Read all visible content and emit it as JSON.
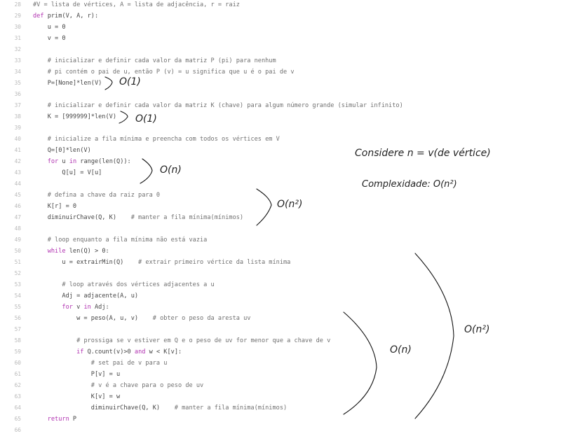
{
  "lines": [
    {
      "n": "28",
      "html": "<span class=\"cm\">#V = lista de vértices, A = lista de adjacência, r = raiz</span>"
    },
    {
      "n": "29",
      "html": "<span class=\"kw\">def</span> prim(V, A, r):"
    },
    {
      "n": "30",
      "html": "    u = 0"
    },
    {
      "n": "31",
      "html": "    v = 0"
    },
    {
      "n": "32",
      "html": ""
    },
    {
      "n": "33",
      "html": "    <span class=\"cm\"># inicializar e definir cada valor da matriz P (pi) para nenhum</span>"
    },
    {
      "n": "34",
      "html": "    <span class=\"cm\"># pi contém o pai de u, então P (v) = u significa que u é o pai de v</span>"
    },
    {
      "n": "35",
      "html": "    P=[None]*len(V)"
    },
    {
      "n": "36",
      "html": ""
    },
    {
      "n": "37",
      "html": "    <span class=\"cm\"># inicializar e definir cada valor da matriz K (chave) para algum número grande (simular infinito)</span>"
    },
    {
      "n": "38",
      "html": "    K = [999999]*len(V)"
    },
    {
      "n": "39",
      "html": ""
    },
    {
      "n": "40",
      "html": "    <span class=\"cm\"># inicialize a fila mínima e preencha com todos os vértices em V</span>"
    },
    {
      "n": "41",
      "html": "    Q=[0]*len(V)"
    },
    {
      "n": "42",
      "html": "    <span class=\"kw\">for</span> u <span class=\"kw\">in</span> range(len(Q)):"
    },
    {
      "n": "43",
      "html": "        Q[u] = V[u]"
    },
    {
      "n": "44",
      "html": ""
    },
    {
      "n": "45",
      "html": "    <span class=\"cm\"># defina a chave da raiz para 0</span>"
    },
    {
      "n": "46",
      "html": "    K[r] = 0"
    },
    {
      "n": "47",
      "html": "    diminuirChave(Q, K)    <span class=\"cm\"># manter a fila mínima(mínimos)</span>"
    },
    {
      "n": "48",
      "html": ""
    },
    {
      "n": "49",
      "html": "    <span class=\"cm\"># loop enquanto a fila mínima não está vazia</span>"
    },
    {
      "n": "50",
      "html": "    <span class=\"kw\">while</span> len(Q) &gt; 0:"
    },
    {
      "n": "51",
      "html": "        u = extrairMin(Q)    <span class=\"cm\"># extrair primeiro vértice da lista mínima</span>"
    },
    {
      "n": "52",
      "html": ""
    },
    {
      "n": "53",
      "html": "        <span class=\"cm\"># loop através dos vértices adjacentes a u</span>"
    },
    {
      "n": "54",
      "html": "        Adj = adjacente(A, u)"
    },
    {
      "n": "55",
      "html": "        <span class=\"kw\">for</span> v <span class=\"kw\">in</span> Adj:"
    },
    {
      "n": "56",
      "html": "            w = peso(A, u, v)    <span class=\"cm\"># obter o peso da aresta uv</span>"
    },
    {
      "n": "57",
      "html": ""
    },
    {
      "n": "58",
      "html": "            <span class=\"cm\"># prossiga se v estiver em Q e o peso de uv for menor que a chave de v</span>"
    },
    {
      "n": "59",
      "html": "            <span class=\"kw\">if</span> Q.count(v)&gt;0 <span class=\"kw\">and</span> w &lt; K[v]:"
    },
    {
      "n": "60",
      "html": "                <span class=\"cm\"># set pai de v para u</span>"
    },
    {
      "n": "61",
      "html": "                P[v] = u"
    },
    {
      "n": "62",
      "html": "                <span class=\"cm\"># v é a chave para o peso de uv</span>"
    },
    {
      "n": "63",
      "html": "                K[v] = w"
    },
    {
      "n": "64",
      "html": "                diminuirChave(Q, K)    <span class=\"cm\"># manter a fila mínima(mínimos)</span>"
    },
    {
      "n": "65",
      "html": "    <span class=\"kw\">return</span> P"
    },
    {
      "n": "66",
      "html": ""
    }
  ],
  "annotations": {
    "o1_a": "O(1)",
    "o1_b": "O(1)",
    "on_a": "O(n)",
    "on2_a": "O(n²)",
    "considere": "Considere n = v(de vértice)",
    "complexidade": "Complexidade: O(n²)",
    "on_b": "O(n)",
    "on2_b": "O(n²)"
  }
}
